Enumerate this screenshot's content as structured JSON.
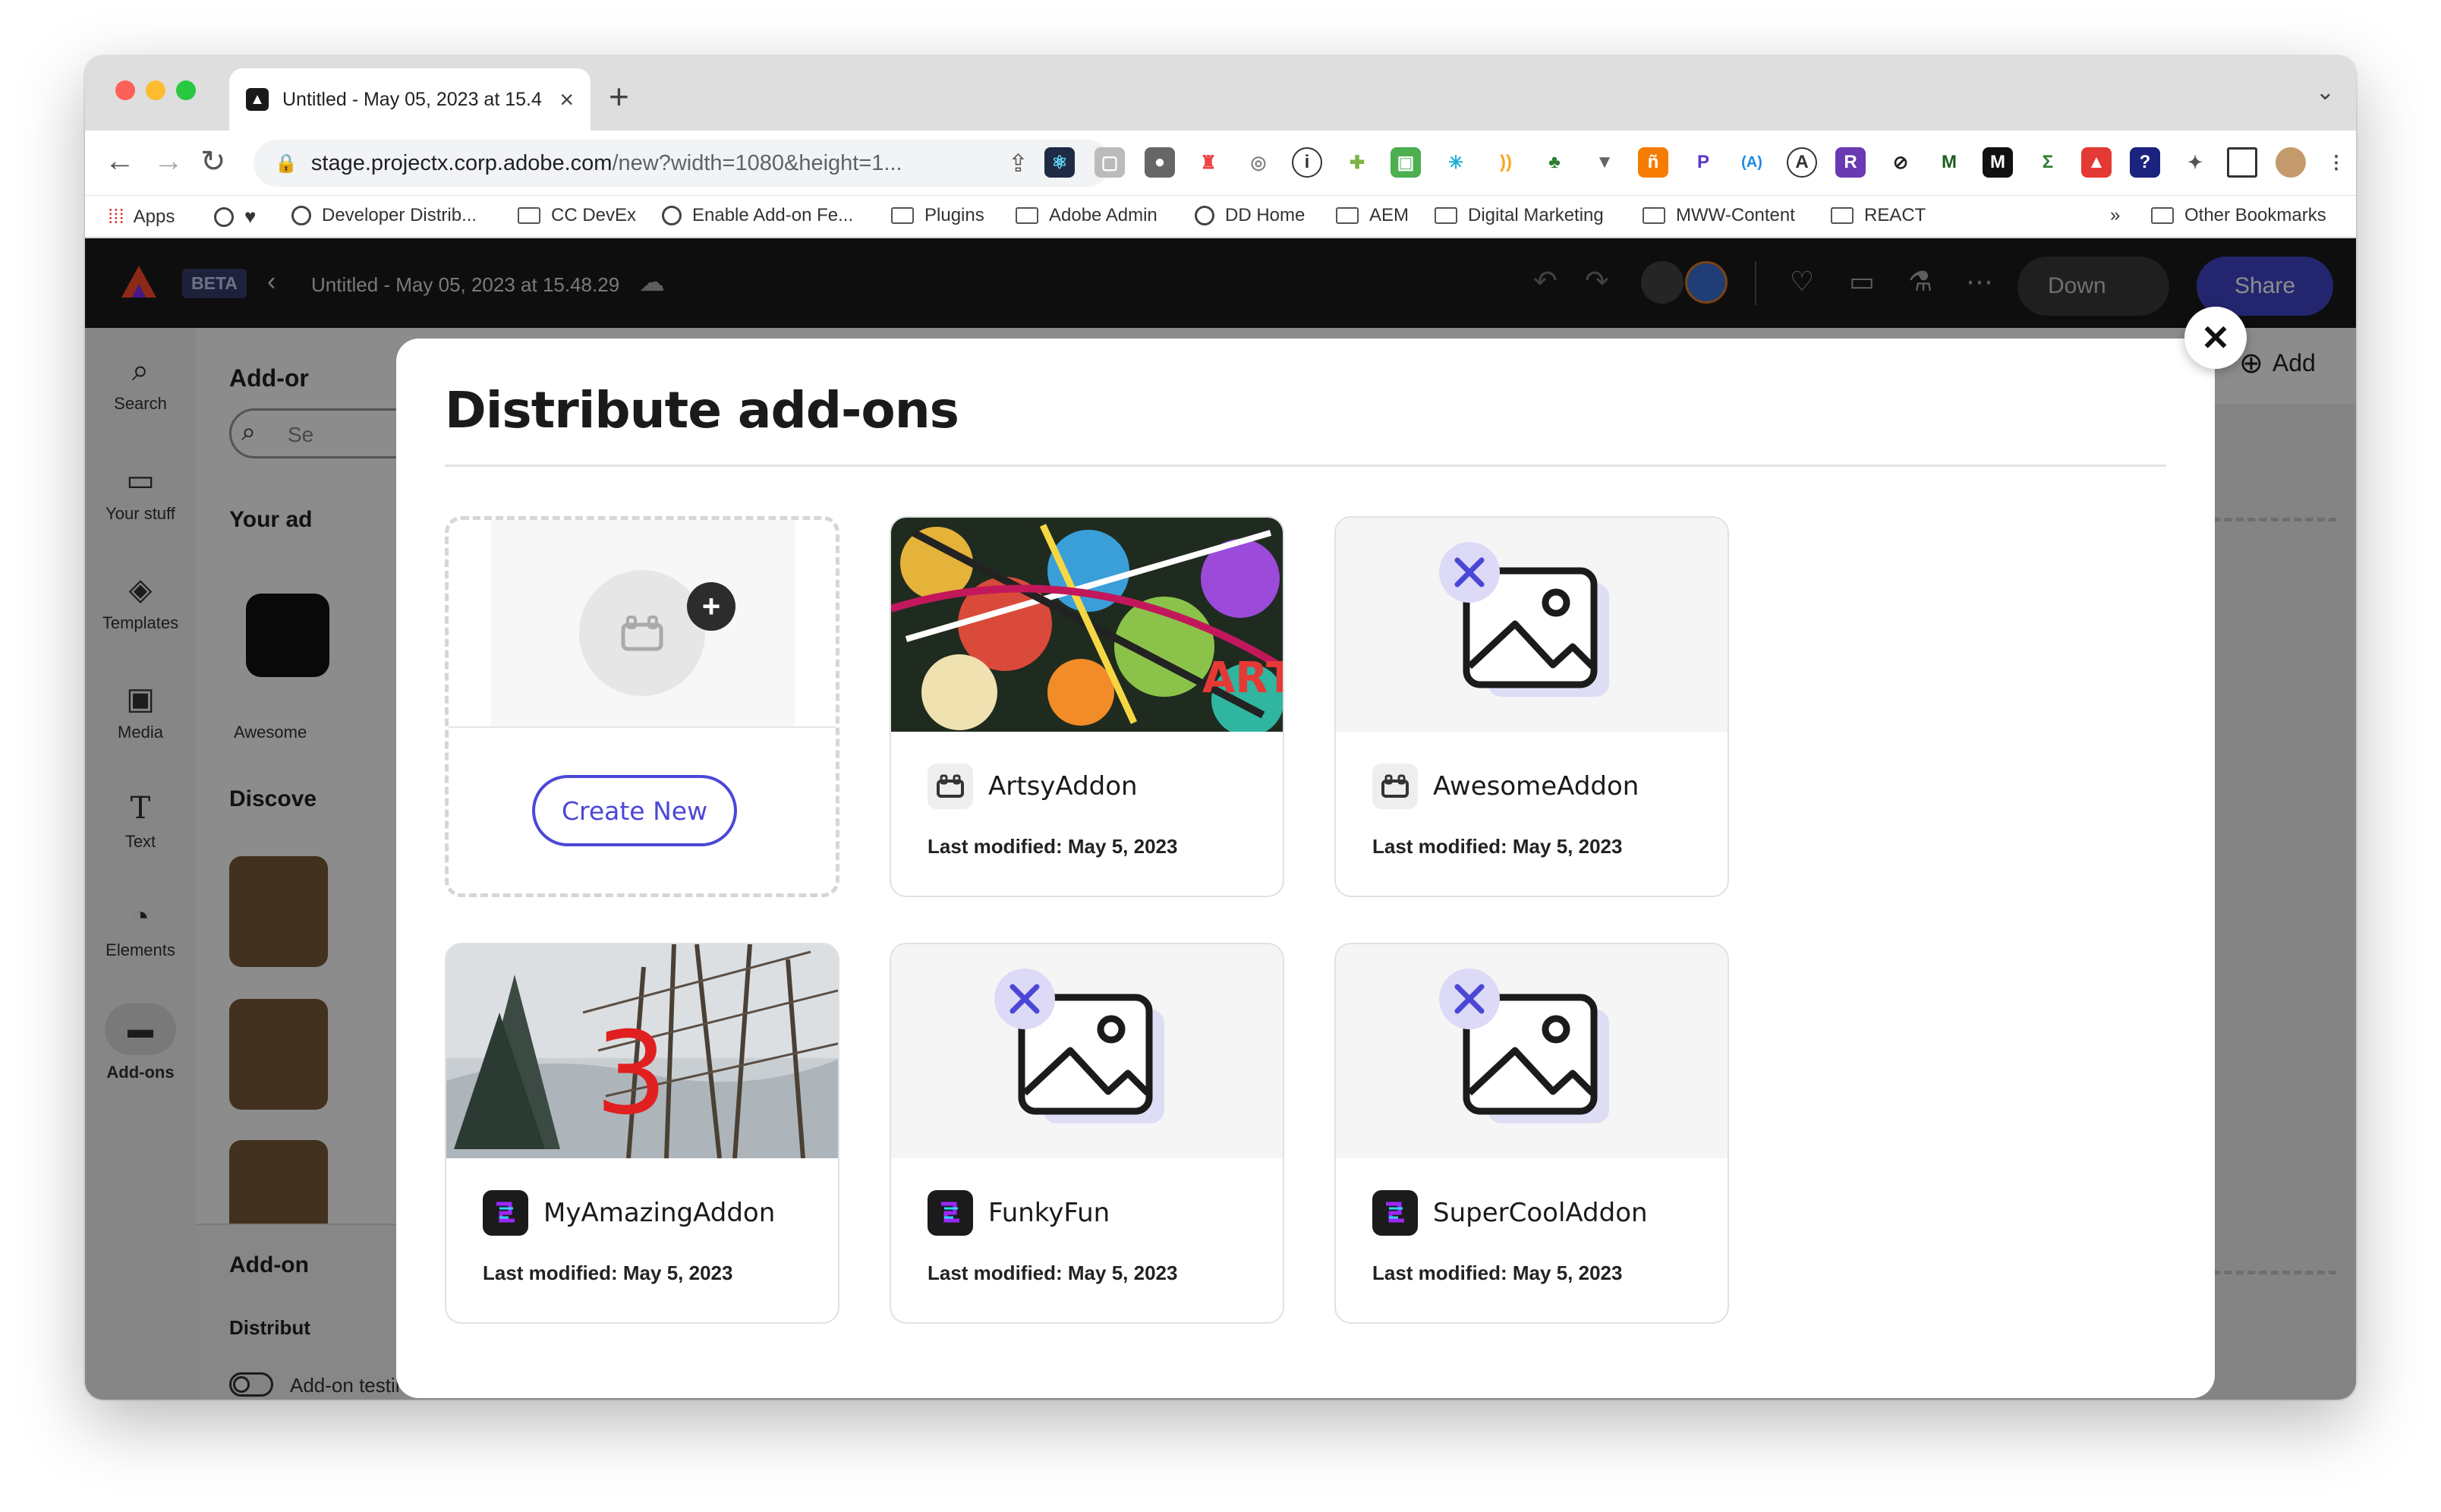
{
  "browser": {
    "tab_title": "Untitled - May 05, 2023 at 15.4",
    "url_host": "stage.projectx.corp.adobe.com",
    "url_path": "/new?width=1080&height=1...",
    "bookmarks": [
      "Apps",
      "Developer Distrib...",
      "CC DevEx",
      "Enable Add-on Fe...",
      "Plugins",
      "Adobe Admin",
      "DD Home",
      "AEM",
      "Digital Marketing",
      "MWW-Content",
      "REACT"
    ],
    "other_bookmarks": "Other Bookmarks",
    "more": "»"
  },
  "app": {
    "beta": "BETA",
    "doc_title": "Untitled - May 05, 2023 at 15.48.29",
    "download": "Down",
    "share": "Share",
    "add": "Add",
    "rail": [
      "Search",
      "Your stuff",
      "Templates",
      "Media",
      "Text",
      "Elements",
      "Add-ons"
    ],
    "panel": {
      "heading": "Add-or",
      "search": "Se",
      "your": "Your ad",
      "awesome": "Awesome",
      "discover": "Discove",
      "addon_section": "Add-on",
      "distribute": "Distribut",
      "testing": "Add-on testing"
    }
  },
  "modal": {
    "title": "Distribute add-ons",
    "create_new": "Create New",
    "cards": [
      {
        "name": "ArtsyAddon",
        "modified": "Last modified: May 5, 2023"
      },
      {
        "name": "AwesomeAddon",
        "modified": "Last modified: May 5, 2023"
      },
      {
        "name": "MyAmazingAddon",
        "modified": "Last modified: May 5, 2023",
        "badge": "3"
      },
      {
        "name": "FunkyFun",
        "modified": "Last modified: May 5, 2023"
      },
      {
        "name": "SuperCoolAddon",
        "modified": "Last modified: May 5, 2023"
      }
    ]
  },
  "colors": {
    "accent": "#4b47d6",
    "share": "#3a3f9e",
    "header": "#1b1b1b"
  }
}
